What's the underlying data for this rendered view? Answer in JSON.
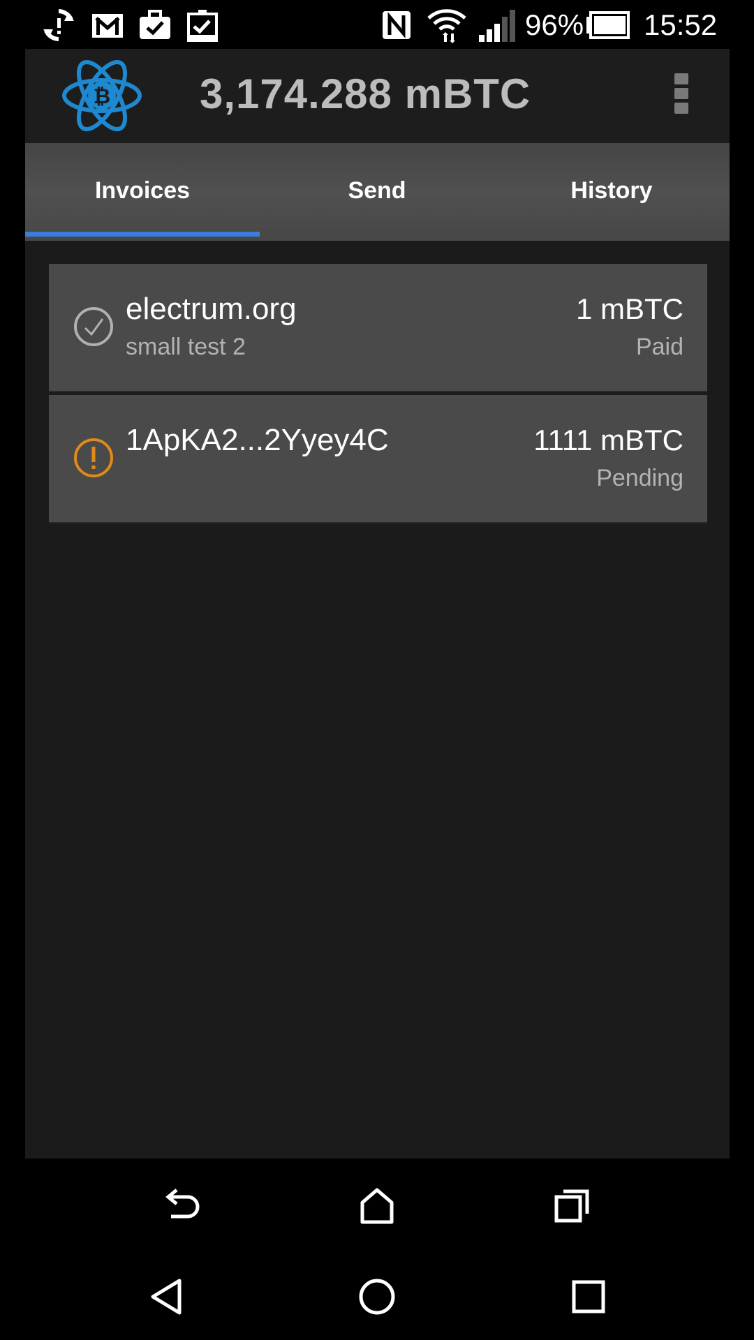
{
  "status_bar": {
    "battery_percent": "96%",
    "time": "15:52",
    "icons": [
      "sync-icon",
      "gmail-icon",
      "briefcase-check-icon",
      "clipboard-check-icon",
      "nfc-icon",
      "wifi-icon",
      "signal-icon",
      "battery-icon"
    ]
  },
  "header": {
    "balance": "3,174.288 mBTC",
    "logo_icon": "electrum-bitcoin-logo",
    "menu_icon": "overflow-menu-icon"
  },
  "tabs": [
    {
      "label": "Invoices",
      "selected": true
    },
    {
      "label": "Send",
      "selected": false
    },
    {
      "label": "History",
      "selected": false
    }
  ],
  "invoices": [
    {
      "title": "electrum.org",
      "subtitle": "small test 2",
      "amount": "1 mBTC",
      "status": "Paid",
      "status_icon": "check-circle-icon"
    },
    {
      "title": "1ApKA2...2Yyey4C",
      "subtitle": "",
      "amount": "1111 mBTC",
      "status": "Pending",
      "status_icon": "exclamation-circle-icon"
    }
  ],
  "colors": {
    "accent": "#3c7ddb",
    "logo": "#1e88d0",
    "pending": "#e08a1a",
    "paid_icon": "#b0b0b0",
    "card_bg": "#4a4a4a"
  },
  "nav": {
    "top_row": [
      "back-arrow-icon",
      "home-icon",
      "recents-icon"
    ],
    "bottom_row": [
      "back-triangle-icon",
      "home-circle-icon",
      "recents-square-icon"
    ]
  }
}
